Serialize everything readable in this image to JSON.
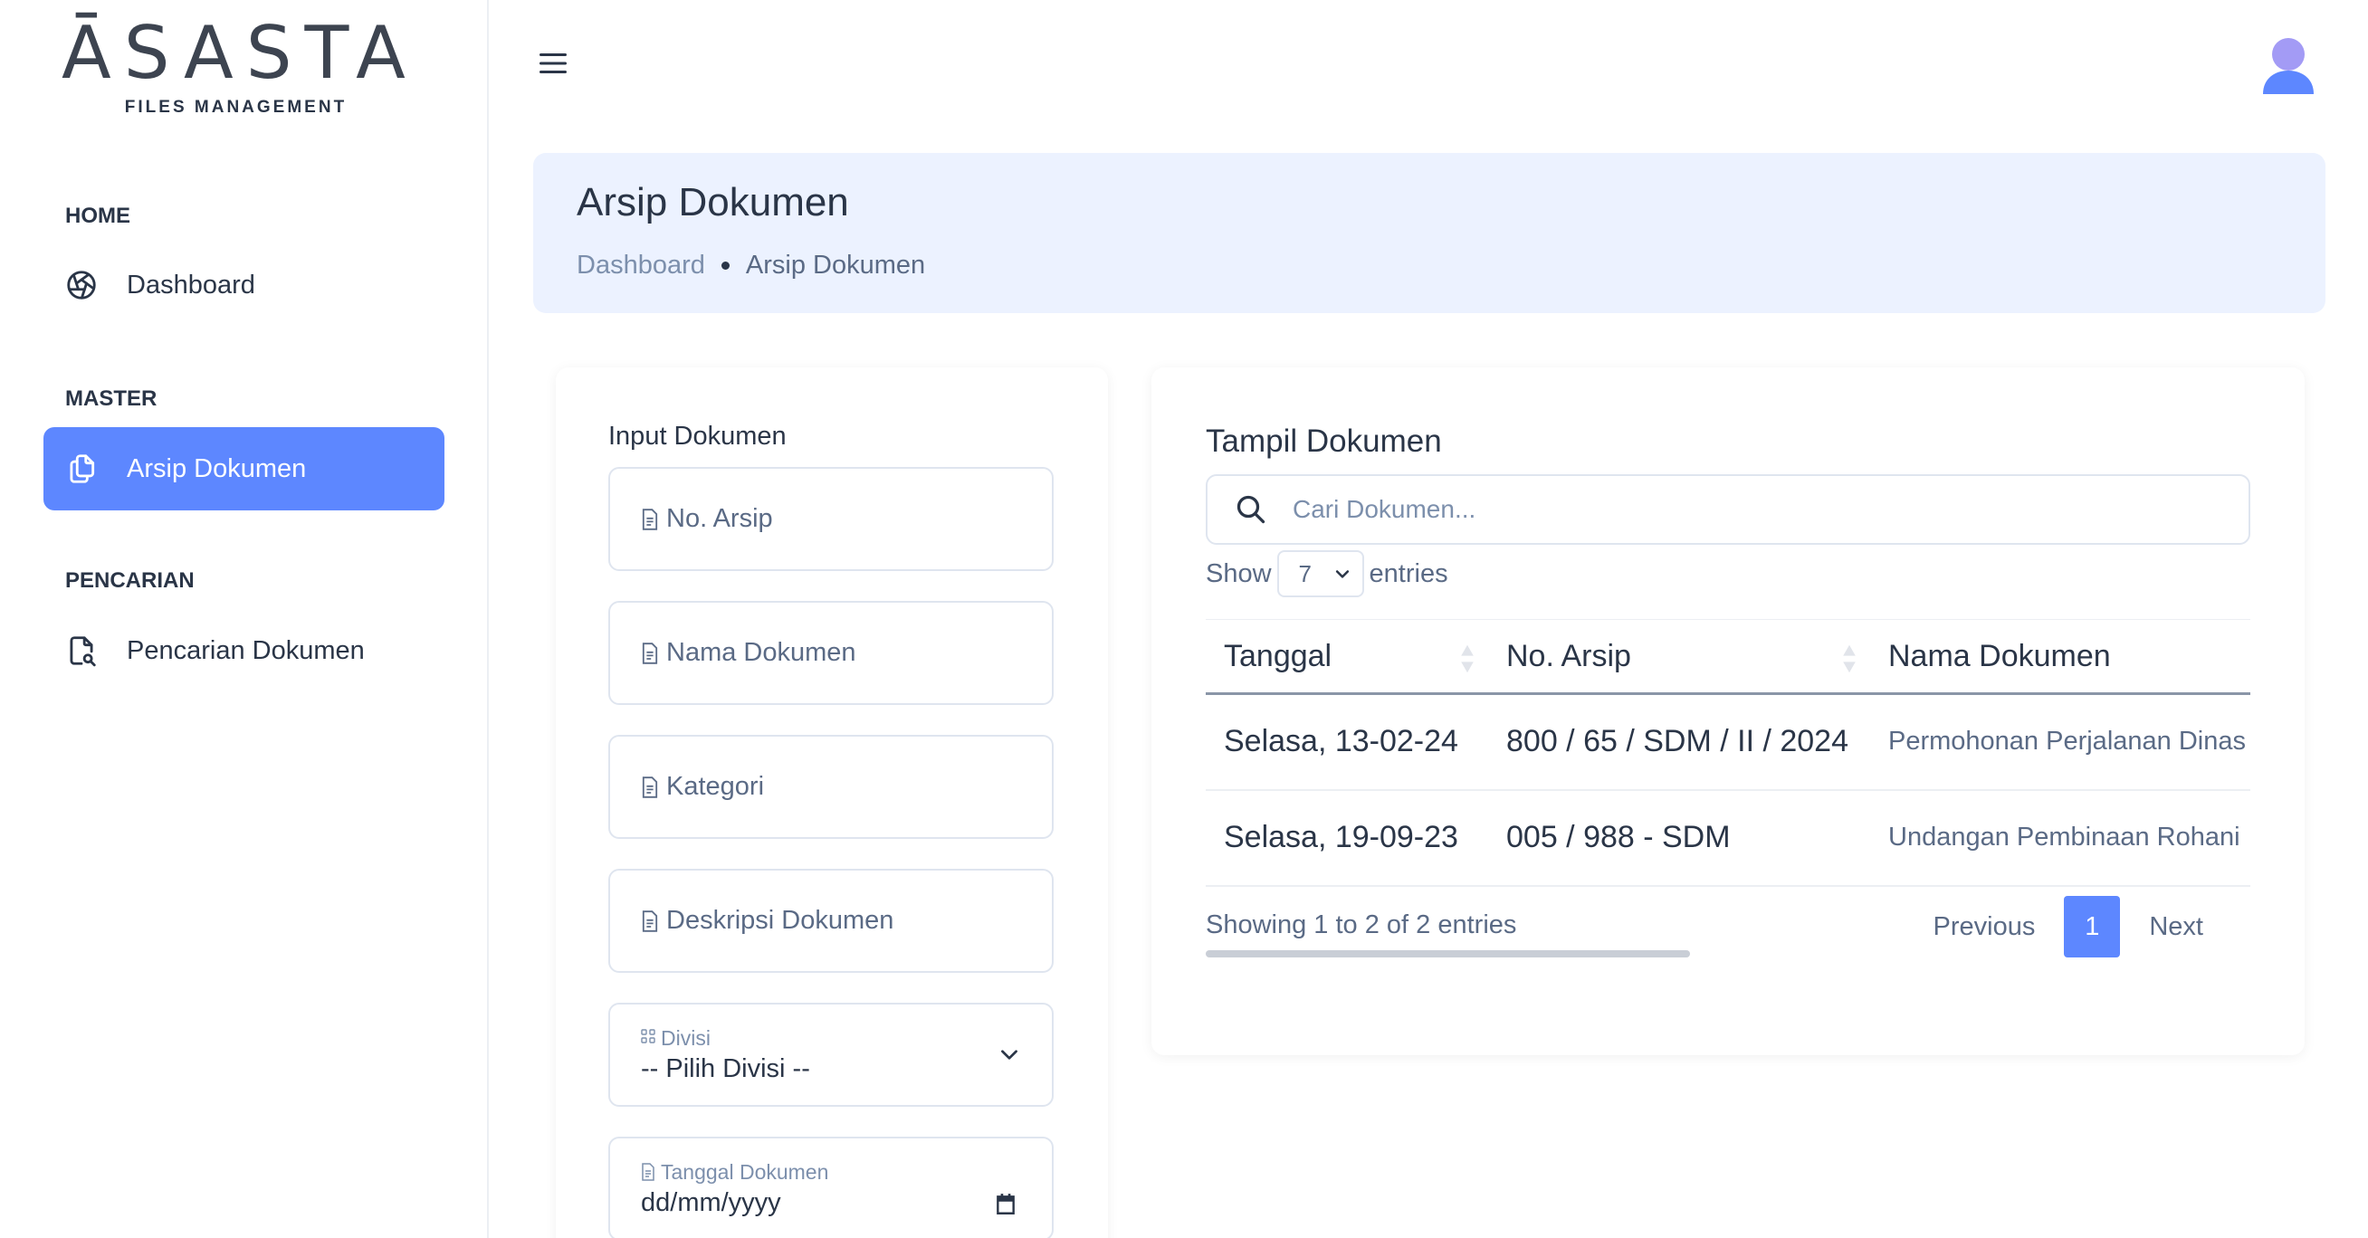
{
  "brand": {
    "logo": "ĀSASTA",
    "tagline": "FILES MANAGEMENT"
  },
  "sidebar": {
    "sections": [
      {
        "title": "HOME",
        "items": [
          {
            "label": "Dashboard",
            "icon": "aperture-icon"
          }
        ]
      },
      {
        "title": "MASTER",
        "items": [
          {
            "label": "Arsip Dokumen",
            "icon": "copy-icon",
            "active": true
          }
        ]
      },
      {
        "title": "PENCARIAN",
        "items": [
          {
            "label": "Pencarian Dokumen",
            "icon": "file-search-icon"
          }
        ]
      }
    ]
  },
  "header": {
    "menu_icon": "hamburger-icon",
    "avatar_icon": "user-avatar-icon"
  },
  "page": {
    "title": "Arsip Dokumen",
    "breadcrumb": [
      "Dashboard",
      "Arsip Dokumen"
    ]
  },
  "input_form": {
    "title": "Input Dokumen",
    "no_arsip_placeholder": "No. Arsip",
    "nama_placeholder": "Nama Dokumen",
    "kategori_placeholder": "Kategori",
    "deskripsi_placeholder": "Deskripsi Dokumen",
    "divisi_label": "Divisi",
    "divisi_value": "-- Pilih Divisi --",
    "tanggal_label": "Tanggal Dokumen",
    "tanggal_value": "dd/mm/yyyy"
  },
  "table_view": {
    "title": "Tampil Dokumen",
    "search_placeholder": "Cari Dokumen...",
    "show_label": "Show",
    "show_value": "7",
    "entries_label": "entries",
    "columns": [
      "Tanggal",
      "No. Arsip",
      "Nama Dokumen"
    ],
    "rows": [
      [
        "Selasa, 13-02-24",
        "800 / 65 / SDM / II / 2024",
        "Permohonan Perjalanan Dinas"
      ],
      [
        "Selasa, 19-09-23",
        "005 / 988 - SDM",
        "Undangan Pembinaan Rohani"
      ]
    ],
    "info": "Showing 1 to 2 of 2 entries",
    "pagination": {
      "previous": "Previous",
      "current": "1",
      "next": "Next"
    }
  },
  "colors": {
    "primary": "#5d87ff",
    "header_bg": "#ecf2ff",
    "text": "#2a3547",
    "muted": "#5a6a85"
  }
}
